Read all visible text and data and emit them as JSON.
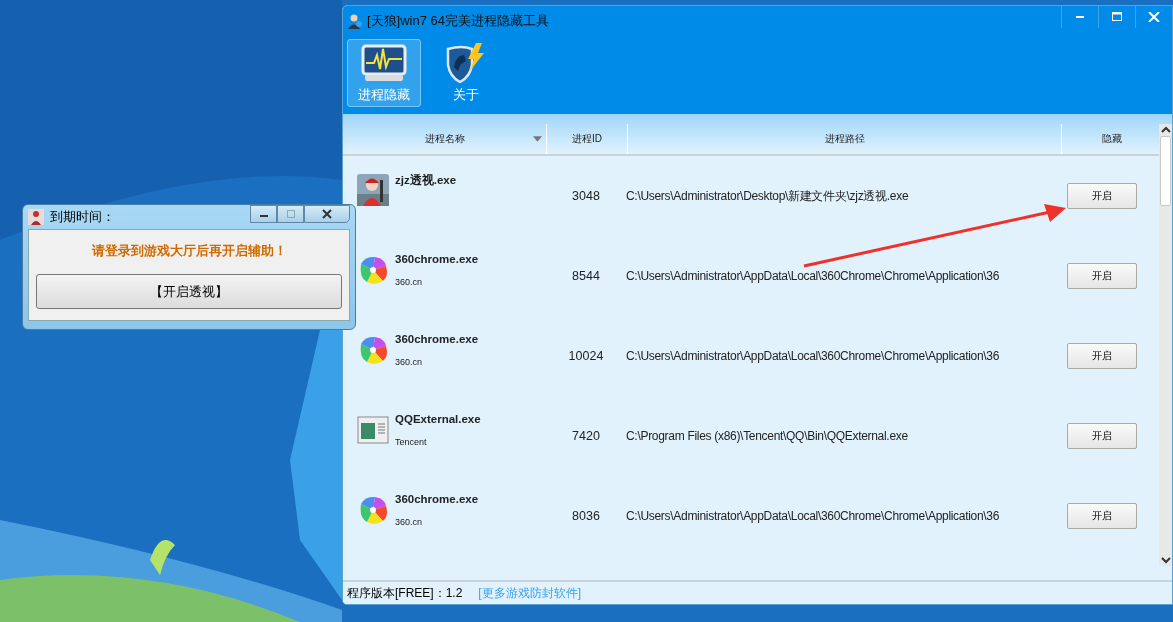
{
  "dialog": {
    "title": "到期时间：",
    "message": "请登录到游戏大厅后再开启辅助！",
    "button": "【开启透视】"
  },
  "window": {
    "title": "[天狼]win7 64完美进程隐藏工具"
  },
  "tabs": [
    {
      "label": "进程隐藏",
      "kind": "monitor",
      "selected": true
    },
    {
      "label": "关于",
      "kind": "shield",
      "selected": false
    }
  ],
  "table": {
    "columns": [
      "进程名称",
      "进程ID",
      "进程路径",
      "隐藏"
    ],
    "rows": [
      {
        "kind": "game",
        "name": "zjz透视.exe",
        "pid": "3048",
        "path": "C:\\Users\\Administrator\\Desktop\\新建文件夹\\zjz透视.exe",
        "button": "开启"
      },
      {
        "kind": "pinwheel",
        "name": "360chrome.exe",
        "company": "360.cn",
        "pid": "8544",
        "path": "C:\\Users\\Administrator\\AppData\\Local\\360Chrome\\Chrome\\Application\\36",
        "button": "开启"
      },
      {
        "kind": "pinwheel",
        "name": "360chrome.exe",
        "company": "360.cn",
        "pid": "10024",
        "path": "C:\\Users\\Administrator\\AppData\\Local\\360Chrome\\Chrome\\Application\\36",
        "button": "开启"
      },
      {
        "kind": "window",
        "name": "QQExternal.exe",
        "company": "Tencent",
        "pid": "7420",
        "path": "C:\\Program Files (x86)\\Tencent\\QQ\\Bin\\QQExternal.exe",
        "button": "开启"
      },
      {
        "kind": "pinwheel",
        "name": "360chrome.exe",
        "company": "360.cn",
        "pid": "8036",
        "path": "C:\\Users\\Administrator\\AppData\\Local\\360Chrome\\Chrome\\Application\\36",
        "button": "开启"
      }
    ]
  },
  "status_bar": {
    "version": "程序版本[FREE]：1.2",
    "link": "[更多游戏防封软件]"
  }
}
